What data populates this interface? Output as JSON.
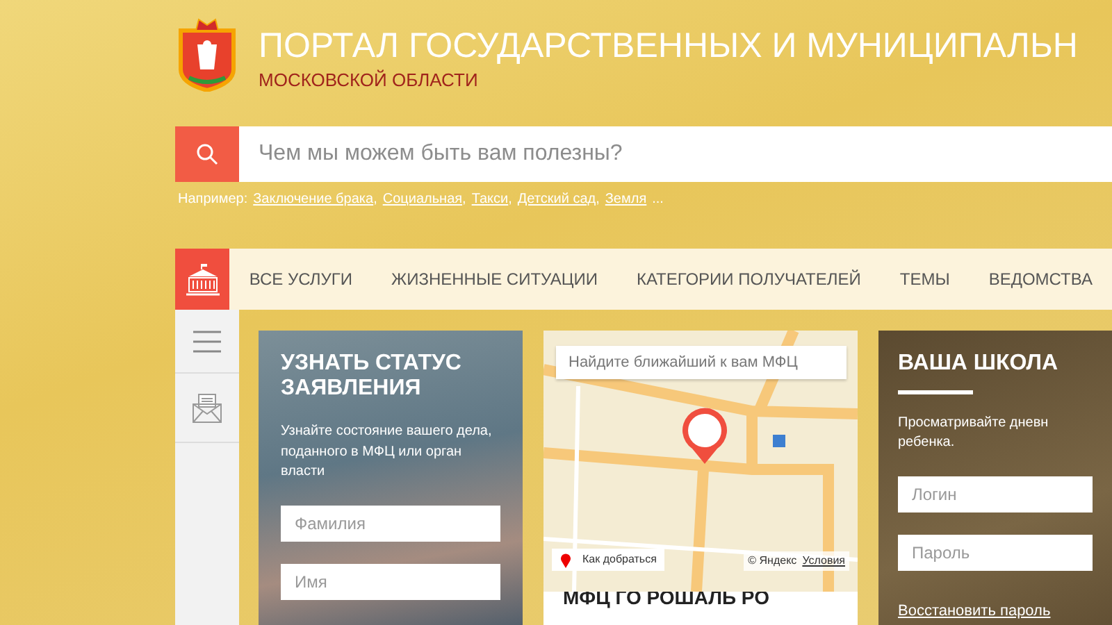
{
  "header": {
    "title": "ПОРТАЛ ГОСУДАРСТВЕННЫХ И МУНИЦИПАЛЬН",
    "subtitle": "МОСКОВСКОЙ ОБЛАСТИ"
  },
  "search": {
    "placeholder": "Чем мы можем быть вам полезны?",
    "examples_label": "Например:",
    "examples": [
      "Заключение брака",
      "Социальная",
      "Такси",
      "Детский сад",
      "Земля"
    ],
    "separator": ",",
    "more": "..."
  },
  "nav": {
    "items": [
      "ВСЕ УСЛУГИ",
      "ЖИЗНЕННЫЕ СИТУАЦИИ",
      "КАТЕГОРИИ ПОЛУЧАТЕЛЕЙ",
      "ТЕМЫ",
      "ВЕДОМСТВА"
    ]
  },
  "status_card": {
    "title": "УЗНАТЬ СТАТУС ЗАЯВЛЕНИЯ",
    "text": "Узнайте состояние вашего дела, поданного в МФЦ или орган власти",
    "fields": [
      {
        "placeholder": "Фамилия"
      },
      {
        "placeholder": "Имя"
      }
    ]
  },
  "map_card": {
    "search_placeholder": "Найдите ближайший к вам МФЦ",
    "route_button": "Как добраться",
    "copyright": "© Яндекс",
    "terms_link": "Условия",
    "title": "МФЦ ГО РОШАЛЬ РО"
  },
  "school_card": {
    "title": "ВАША ШКОЛА",
    "text_lines": [
      "Просматривайте дневн",
      "ребенка."
    ],
    "fields": [
      {
        "placeholder": "Логин"
      },
      {
        "placeholder": "Пароль"
      }
    ],
    "link": "Восстановить пароль"
  }
}
